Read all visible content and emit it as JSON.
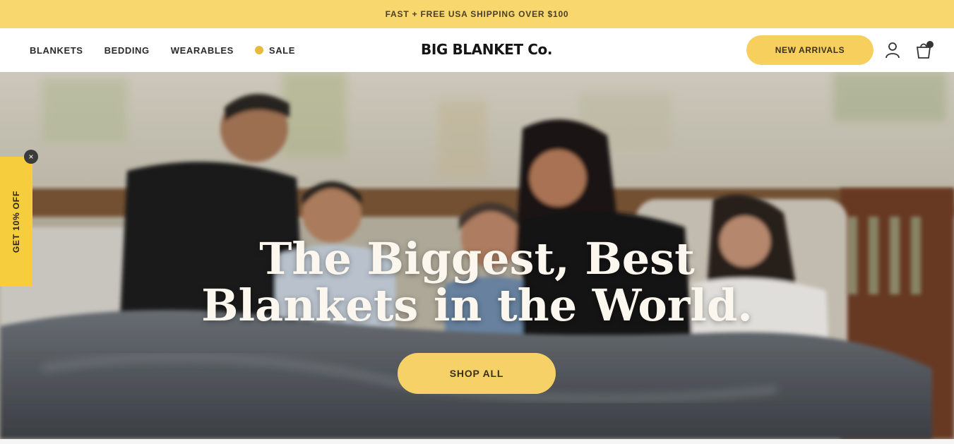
{
  "announcement": {
    "text": "FAST + FREE USA SHIPPING OVER $100"
  },
  "nav": {
    "links": [
      {
        "label": "BLANKETS"
      },
      {
        "label": "BEDDING"
      },
      {
        "label": "WEARABLES"
      },
      {
        "label": "SALE"
      }
    ],
    "logo": "BIG BLANKET Co.",
    "cta": "NEW ARRIVALS"
  },
  "hero": {
    "headline_line1": "The Biggest, Best",
    "headline_line2": "Blankets in the World.",
    "button": "SHOP ALL"
  },
  "side_tab": {
    "label": "GET 10% OFF",
    "close": "×"
  },
  "colors": {
    "accent": "#f8d86e",
    "button": "#f6d168",
    "tab": "#f6cd3c"
  },
  "icons": [
    "account-icon",
    "cart-icon",
    "close-icon"
  ]
}
